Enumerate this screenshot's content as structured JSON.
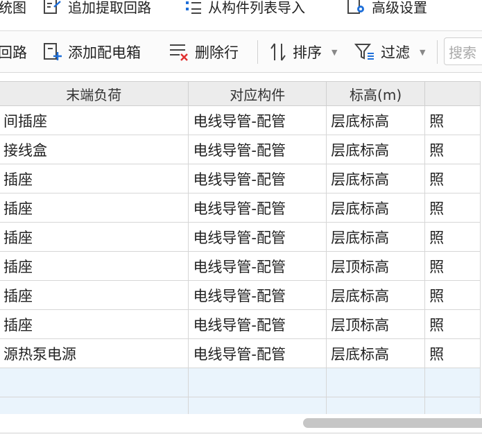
{
  "toolbar_top": {
    "view_label": "统图",
    "append_extract_label": "追加提取回路",
    "import_from_list_label": "从构件列表导入",
    "advanced_settings_label": "高级设置"
  },
  "toolbar_main": {
    "circuit_label": "回路",
    "add_distribution_box_label": "添加配电箱",
    "delete_row_label": "删除行",
    "sort_label": "排序",
    "filter_label": "过滤",
    "search_placeholder": "搜索"
  },
  "table": {
    "columns": [
      "末端负荷",
      "对应构件",
      "标高(m)",
      ""
    ],
    "rows": [
      [
        "间插座",
        "电线导管-配管",
        "层底标高",
        "照"
      ],
      [
        "接线盒",
        "电线导管-配管",
        "层底标高",
        "照"
      ],
      [
        "插座",
        "电线导管-配管",
        "层底标高",
        "照"
      ],
      [
        "插座",
        "电线导管-配管",
        "层底标高",
        "照"
      ],
      [
        "插座",
        "电线导管-配管",
        "层底标高",
        "照"
      ],
      [
        "插座",
        "电线导管-配管",
        "层顶标高",
        "照"
      ],
      [
        "插座",
        "电线导管-配管",
        "层底标高",
        "照"
      ],
      [
        "插座",
        "电线导管-配管",
        "层顶标高",
        "照"
      ],
      [
        "源热泵电源",
        "电线导管-配管",
        "层底标高",
        "照"
      ],
      [
        "",
        "",
        "",
        ""
      ],
      [
        "",
        "",
        "",
        ""
      ]
    ]
  },
  "colors": {
    "accent_blue": "#1e6fd9",
    "delete_red": "#e03030",
    "empty_row_bg": "#eaf4fc",
    "header_bg": "#ececec"
  }
}
